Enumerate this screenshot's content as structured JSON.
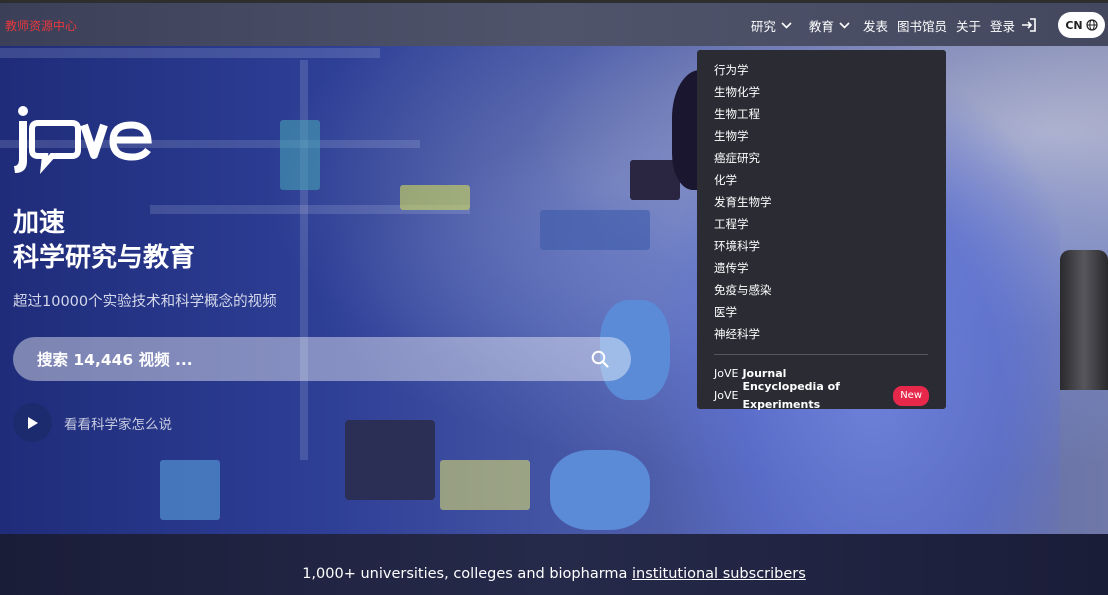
{
  "topbar": {
    "teacher_link": "教师资源中心",
    "nav": [
      {
        "label": "研究",
        "has_dropdown": true
      },
      {
        "label": "教育",
        "has_dropdown": true
      },
      {
        "label": "发表",
        "has_dropdown": false
      },
      {
        "label": "图书馆员",
        "has_dropdown": false
      },
      {
        "label": "关于",
        "has_dropdown": false
      }
    ],
    "login_label": "登录",
    "language_label": "CN"
  },
  "logo": {
    "text": "jove"
  },
  "hero": {
    "headline_line1": "加速",
    "headline_line2": "科学研究与教育",
    "subtitle": "超过10000个实验技术和科学概念的视频",
    "search_placeholder": "搜索 14,446 视频 ...",
    "play_label": "看看科学家怎么说"
  },
  "research_dropdown": {
    "subjects": [
      "行为学",
      "生物化学",
      "生物工程",
      "生物学",
      "癌症研究",
      "化学",
      "发育生物学",
      "工程学",
      "环境科学",
      "遗传学",
      "免疫与感染",
      "医学",
      "神经科学"
    ],
    "journal_prefix": "JoVE",
    "journal_name": "Journal",
    "encyclopedia_prefix": "JoVE",
    "encyclopedia_name": "Encyclopedia of Experiments",
    "new_badge": "New"
  },
  "bottom": {
    "subscriber_text": "1,000+ universities, colleges and biopharma ",
    "subscriber_link": "institutional subscribers"
  },
  "colors": {
    "teacher_link": "#e8383d",
    "new_badge": "#e8284a",
    "dropdown_bg": "#2a2b33",
    "play_button": "#1c2a6e"
  }
}
